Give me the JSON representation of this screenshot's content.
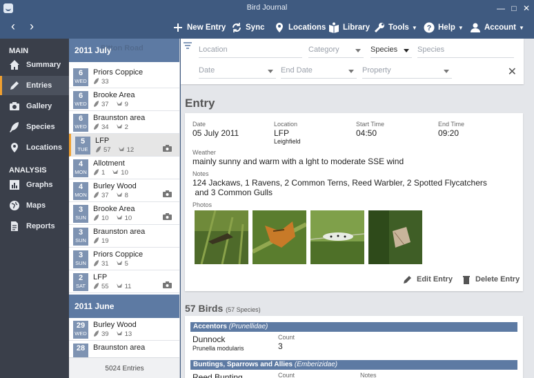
{
  "window": {
    "title": "Bird Journal",
    "min": "—",
    "max": "□",
    "close": "✕"
  },
  "toolbar": {
    "back": "‹",
    "forward": "›",
    "new_entry": "New Entry",
    "sync": "Sync",
    "locations": "Locations",
    "library": "Library",
    "tools": "Tools",
    "help": "Help",
    "account": "Account"
  },
  "sidebar": {
    "main_label": "MAIN",
    "analysis_label": "ANALYSIS",
    "main_items": [
      {
        "label": "Summary",
        "icon": "home-icon"
      },
      {
        "label": "Entries",
        "icon": "pencil-icon"
      },
      {
        "label": "Gallery",
        "icon": "camera-icon"
      },
      {
        "label": "Species",
        "icon": "feather-icon"
      },
      {
        "label": "Locations",
        "icon": "pin-icon"
      }
    ],
    "analysis_items": [
      {
        "label": "Graphs",
        "icon": "chart-icon"
      },
      {
        "label": "Maps",
        "icon": "globe-icon"
      },
      {
        "label": "Reports",
        "icon": "document-icon"
      }
    ]
  },
  "entries": {
    "month1": "2011 July",
    "ghost_text": "Pitton Road",
    "month2": "2011 June",
    "footer": "5024 Entries",
    "rows": [
      {
        "day": "6",
        "wd": "WED",
        "name": "Priors Coppice",
        "a": "33",
        "b": "",
        "photo": false
      },
      {
        "day": "6",
        "wd": "WED",
        "name": "Brooke Area",
        "a": "37",
        "b": "9",
        "photo": false
      },
      {
        "day": "6",
        "wd": "WED",
        "name": "Braunston area",
        "a": "34",
        "b": "2",
        "photo": false
      },
      {
        "day": "5",
        "wd": "TUE",
        "name": "LFP",
        "a": "57",
        "b": "12",
        "photo": true
      },
      {
        "day": "4",
        "wd": "MON",
        "name": "Allotment",
        "a": "1",
        "b": "10",
        "photo": false
      },
      {
        "day": "4",
        "wd": "MON",
        "name": "Burley Wood",
        "a": "37",
        "b": "8",
        "photo": true
      },
      {
        "day": "3",
        "wd": "SUN",
        "name": "Brooke Area",
        "a": "10",
        "b": "10",
        "photo": true
      },
      {
        "day": "3",
        "wd": "SUN",
        "name": "Braunston area",
        "a": "19",
        "b": "",
        "photo": false
      },
      {
        "day": "3",
        "wd": "SUN",
        "name": "Priors Coppice",
        "a": "31",
        "b": "5",
        "photo": false
      },
      {
        "day": "2",
        "wd": "SAT",
        "name": "LFP",
        "a": "55",
        "b": "11",
        "photo": true
      }
    ],
    "june_rows": [
      {
        "day": "29",
        "wd": "WED",
        "name": "Burley Wood",
        "a": "39",
        "b": "13",
        "photo": false
      },
      {
        "day": "28",
        "wd": "",
        "name": "Braunston area",
        "a": "",
        "b": "",
        "photo": false
      }
    ]
  },
  "filter": {
    "location": "Location",
    "category": "Category",
    "species_sel": "Species",
    "species": "Species",
    "date": "Date",
    "end_date": "End Date",
    "property": "Property"
  },
  "entry": {
    "heading": "Entry",
    "date_label": "Date",
    "date": "05 July 2011",
    "location_label": "Location",
    "location": "LFP",
    "location_sub": "Leighfield",
    "start_label": "Start Time",
    "start": "04:50",
    "end_label": "End Time",
    "end": "09:20",
    "weather_label": "Weather",
    "weather": "mainly sunny and warm with a lght to moderate SSE wind",
    "notes_label": "Notes",
    "notes_line1": "124 Jackaws, 1 Ravens, 2 Common Terns, Reed Warbler, 2 Spotted Flycatchers",
    "notes_line2": " and 3 Common Gulls",
    "photos_label": "Photos",
    "edit": "Edit Entry",
    "delete": "Delete Entry"
  },
  "birds": {
    "heading": "57 Birds",
    "species_count": "(57 Species)",
    "fam1": "Accentors",
    "fam1_latin": "(Prunellidae)",
    "bird1": "Dunnock",
    "bird1_latin": "Prunella modularis",
    "count_label": "Count",
    "bird1_count": "3",
    "fam2": "Buntings, Sparrows and Allies",
    "fam2_latin": "(Emberizidae)",
    "bird2": "Reed Bunting",
    "count_label2": "Count",
    "notes_label": "Notes"
  },
  "colors": {
    "accent": "#f0a030",
    "header_blue": "#3f5a80",
    "month_blue": "#5d7aa3",
    "sidebar": "#3a3f4a"
  }
}
